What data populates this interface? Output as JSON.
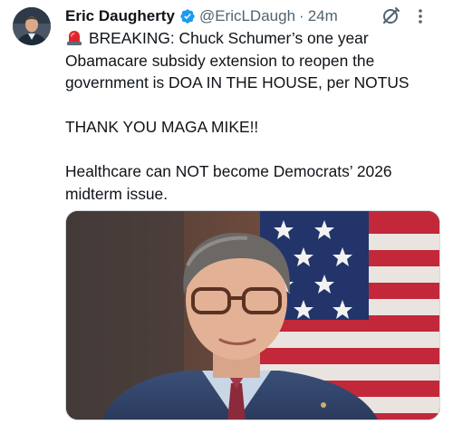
{
  "tweet": {
    "author": {
      "display_name": "Eric Daugherty",
      "handle": "@EricLDaugh",
      "separator": "·",
      "time": "24m"
    },
    "text": {
      "line1": "BREAKING: Chuck Schumer’s one year Obamacare subsidy extension to reopen the government is DOA IN THE HOUSE, per NOTUS",
      "line2": "THANK YOU MAGA MIKE!!",
      "line3": "Healthcare can NOT become Democrats’ 2026 midterm issue."
    },
    "icons": {
      "verified": "verified-badge-icon",
      "siren": "siren-emoji-icon",
      "grok": "grok-icon",
      "more": "more-vertical-icon"
    },
    "colors": {
      "verified": "#1d9bf0",
      "secondary_text": "#536471",
      "primary_text": "#0f1419"
    }
  }
}
